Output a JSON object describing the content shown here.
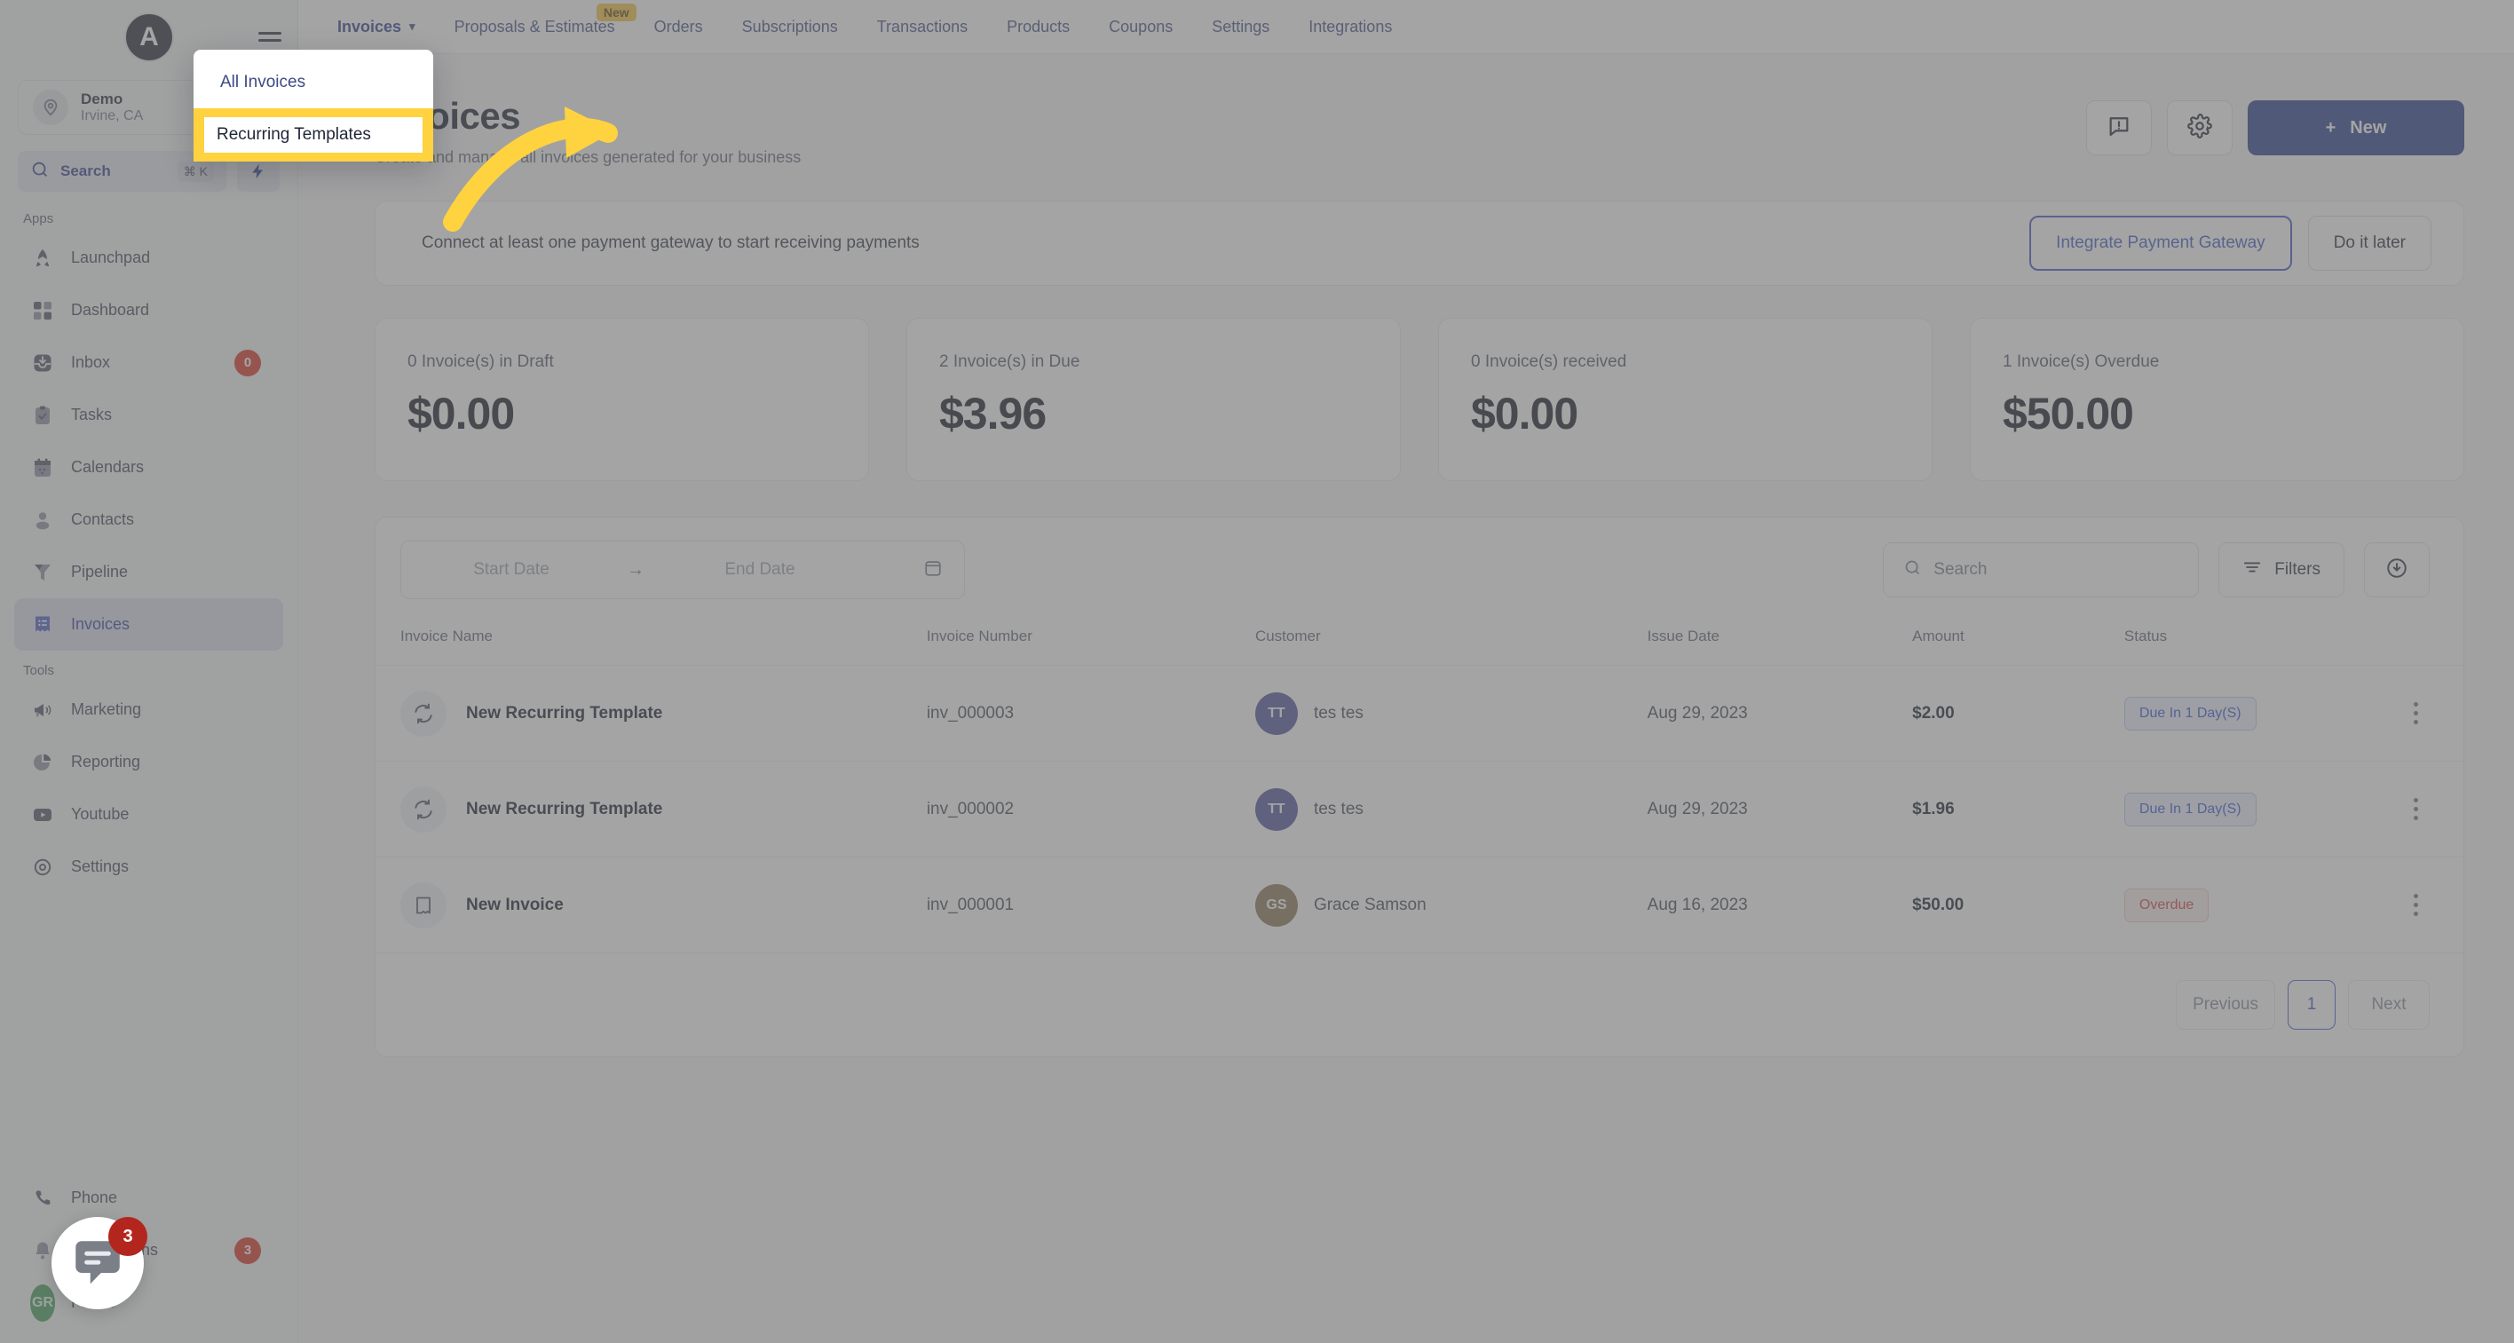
{
  "brand": {
    "logo_letter": "A",
    "accent": "#253a8c",
    "highlight": "#ffd23f"
  },
  "sidebar": {
    "location": {
      "name": "Demo",
      "sub": "Irvine, CA"
    },
    "search": {
      "label": "Search",
      "shortcut": "⌘ K"
    },
    "groups": [
      {
        "label": "Apps",
        "items": [
          {
            "label": "Launchpad",
            "icon": "rocket-icon",
            "badge": ""
          },
          {
            "label": "Dashboard",
            "icon": "grid-icon",
            "badge": ""
          },
          {
            "label": "Inbox",
            "icon": "inbox-icon",
            "badge": "0"
          },
          {
            "label": "Tasks",
            "icon": "clipboard-check-icon",
            "badge": ""
          },
          {
            "label": "Calendars",
            "icon": "calendar-icon",
            "badge": ""
          },
          {
            "label": "Contacts",
            "icon": "user-icon",
            "badge": ""
          },
          {
            "label": "Pipeline",
            "icon": "funnel-icon",
            "badge": ""
          },
          {
            "label": "Invoices",
            "icon": "invoice-icon",
            "badge": "",
            "active": true
          }
        ]
      },
      {
        "label": "Tools",
        "items": [
          {
            "label": "Marketing",
            "icon": "megaphone-icon",
            "badge": ""
          },
          {
            "label": "Reporting",
            "icon": "pie-chart-icon",
            "badge": ""
          },
          {
            "label": "Youtube",
            "icon": "youtube-icon",
            "badge": ""
          },
          {
            "label": "Settings",
            "icon": "gear-icon",
            "badge": ""
          }
        ]
      }
    ],
    "bottom": [
      {
        "label": "Phone",
        "icon": "phone-icon",
        "badge": ""
      },
      {
        "label": "Notifications",
        "icon": "bell-icon",
        "badge": "3"
      },
      {
        "label": "Profile",
        "icon": "avatar-icon",
        "badge": "",
        "initials": "GR"
      }
    ]
  },
  "topnav": {
    "items": [
      {
        "label": "Invoices",
        "active": true,
        "caret": true,
        "badge": ""
      },
      {
        "label": "Proposals & Estimates",
        "active": false,
        "caret": false,
        "badge": "New"
      },
      {
        "label": "Orders",
        "active": false,
        "caret": false,
        "badge": ""
      },
      {
        "label": "Subscriptions",
        "active": false,
        "caret": false,
        "badge": ""
      },
      {
        "label": "Transactions",
        "active": false,
        "caret": false,
        "badge": ""
      },
      {
        "label": "Products",
        "active": false,
        "caret": false,
        "badge": ""
      },
      {
        "label": "Coupons",
        "active": false,
        "caret": false,
        "badge": ""
      },
      {
        "label": "Settings",
        "active": false,
        "caret": false,
        "badge": ""
      },
      {
        "label": "Integrations",
        "active": false,
        "caret": false,
        "badge": ""
      }
    ]
  },
  "dropdown": {
    "items": [
      {
        "label": "All Invoices",
        "highlighted": false
      },
      {
        "label": "Recurring Templates",
        "highlighted": true
      }
    ]
  },
  "page": {
    "title": "Invoices",
    "subtitle": "Create and manage all invoices generated for your business",
    "new_button": "New",
    "plus": "+"
  },
  "banner": {
    "text": "Connect at least one payment gateway to start receiving payments",
    "primary_action": "Integrate Payment Gateway",
    "secondary_action": "Do it later"
  },
  "stats": [
    {
      "label": "0 Invoice(s) in Draft",
      "value": "$0.00"
    },
    {
      "label": "2 Invoice(s) in Due",
      "value": "$3.96"
    },
    {
      "label": "0 Invoice(s) received",
      "value": "$0.00"
    },
    {
      "label": "1 Invoice(s) Overdue",
      "value": "$50.00"
    }
  ],
  "toolbar": {
    "start_date_placeholder": "Start Date",
    "end_date_placeholder": "End Date",
    "range_arrow": "→",
    "search_placeholder": "Search",
    "filters_label": "Filters"
  },
  "table": {
    "columns": [
      "Invoice Name",
      "Invoice Number",
      "Customer",
      "Issue Date",
      "Amount",
      "Status"
    ],
    "rows": [
      {
        "icon": "recurring-icon",
        "name": "New Recurring Template",
        "number": "inv_000003",
        "customer": "tes tes",
        "initials": "TT",
        "avatar_color": "#4b4f9e",
        "issue_date": "Aug 29, 2023",
        "amount": "$2.00",
        "status": "Due In 1 Day(S)",
        "status_kind": "due"
      },
      {
        "icon": "recurring-icon",
        "name": "New Recurring Template",
        "number": "inv_000002",
        "customer": "tes tes",
        "initials": "TT",
        "avatar_color": "#4b4f9e",
        "issue_date": "Aug 29, 2023",
        "amount": "$1.96",
        "status": "Due In 1 Day(S)",
        "status_kind": "due"
      },
      {
        "icon": "document-icon",
        "name": "New Invoice",
        "number": "inv_000001",
        "customer": "Grace Samson",
        "initials": "GS",
        "avatar_color": "#8b7355",
        "issue_date": "Aug 16, 2023",
        "amount": "$50.00",
        "status": "Overdue",
        "status_kind": "overdue"
      }
    ]
  },
  "pagination": {
    "previous": "Previous",
    "current": "1",
    "next": "Next"
  },
  "chat": {
    "badge": "3"
  }
}
